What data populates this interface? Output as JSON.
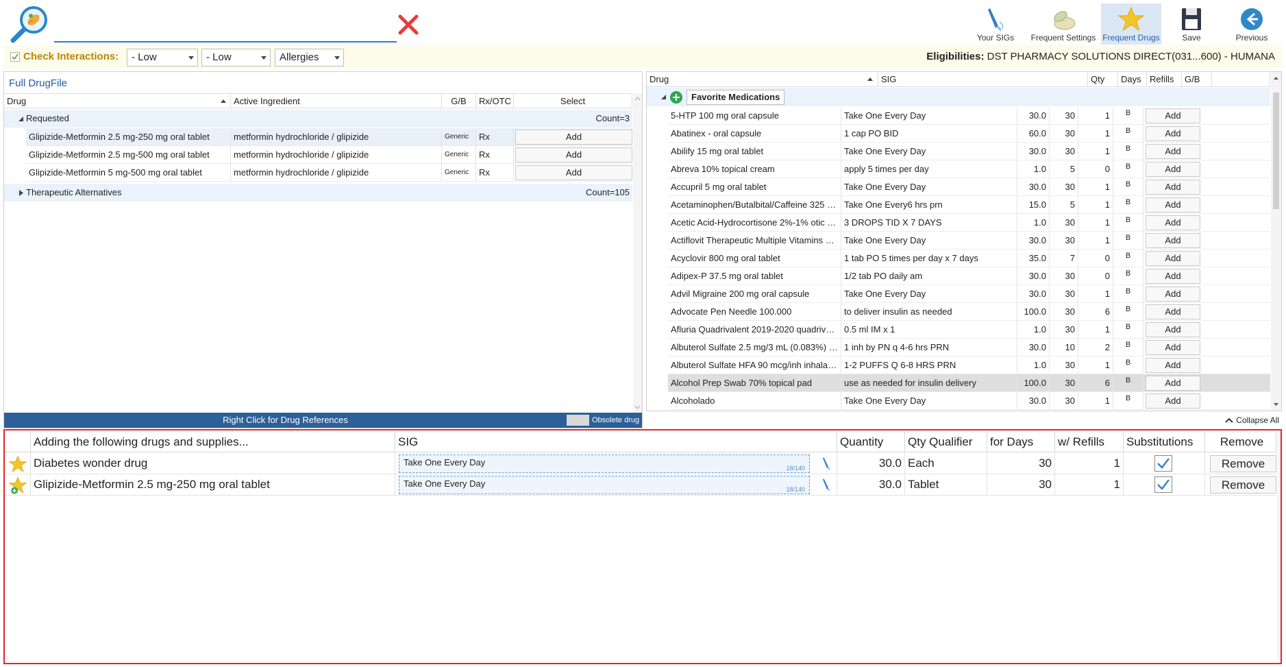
{
  "search": {
    "value": "",
    "placeholder": ""
  },
  "toolbar": {
    "your_sigs": "Your SIGs",
    "frequent_settings": "Frequent Settings",
    "frequent_drugs": "Frequent Drugs",
    "save": "Save",
    "previous": "Previous"
  },
  "interactions": {
    "label": "Check Interactions:",
    "severity1": "- Low",
    "severity2": "- Low",
    "allergies": "Allergies"
  },
  "eligibility": {
    "label": "Eligibilities:",
    "value": "DST PHARMACY SOLUTIONS DIRECT(031...600) - HUMANA"
  },
  "left": {
    "title": "Full DrugFile",
    "columns": {
      "drug": "Drug",
      "ingredient": "Active Ingredient",
      "gb": "G/B",
      "rxotc": "Rx/OTC",
      "select": "Select"
    },
    "requested": {
      "label": "Requested",
      "count": "Count=3"
    },
    "rows": [
      {
        "drug": "Glipizide-Metformin 2.5 mg-250 mg oral tablet",
        "ingredient": "metformin hydrochloride / glipizide",
        "gb": "Generic",
        "rx": "Rx",
        "action": "Add"
      },
      {
        "drug": "Glipizide-Metformin 2.5 mg-500 mg oral tablet",
        "ingredient": "metformin hydrochloride / glipizide",
        "gb": "Generic",
        "rx": "Rx",
        "action": "Add"
      },
      {
        "drug": "Glipizide-Metformin 5 mg-500 mg oral tablet",
        "ingredient": "metformin hydrochloride / glipizide",
        "gb": "Generic",
        "rx": "Rx",
        "action": "Add"
      }
    ],
    "alternatives": {
      "label": "Therapeutic Alternatives",
      "count": "Count=105"
    },
    "footer": "Right Click for Drug References",
    "obsolete": "Obsolete drug"
  },
  "right": {
    "columns": {
      "drug": "Drug",
      "sig": "SIG",
      "qty": "Qty",
      "days": "Days",
      "refills": "Refills",
      "gb": "G/B"
    },
    "group": "Favorite Medications",
    "rows": [
      {
        "drug": "5-HTP 100 mg oral capsule",
        "sig": "Take One Every Day",
        "qty": "30.0",
        "days": "30",
        "refills": "1",
        "gb": "B",
        "action": "Add"
      },
      {
        "drug": "Abatinex - oral capsule",
        "sig": "1 cap PO BID",
        "qty": "60.0",
        "days": "30",
        "refills": "1",
        "gb": "B",
        "action": "Add"
      },
      {
        "drug": "Abilify 15 mg oral tablet",
        "sig": "Take One Every Day",
        "qty": "30.0",
        "days": "30",
        "refills": "1",
        "gb": "B",
        "action": "Add"
      },
      {
        "drug": "Abreva 10% topical cream",
        "sig": "apply 5 times per day",
        "qty": "1.0",
        "days": "5",
        "refills": "0",
        "gb": "B",
        "action": "Add"
      },
      {
        "drug": "Accupril 5 mg oral tablet",
        "sig": "Take One Every Day",
        "qty": "30.0",
        "days": "30",
        "refills": "1",
        "gb": "B",
        "action": "Add"
      },
      {
        "drug": "Acetaminophen/Butalbital/Caffeine 325 mg-5...",
        "sig": "Take One Every6 hrs prn",
        "qty": "15.0",
        "days": "5",
        "refills": "1",
        "gb": "B",
        "action": "Add"
      },
      {
        "drug": "Acetic Acid-Hydrocortisone 2%-1% otic solution",
        "sig": "3 DROPS TID X 7 DAYS",
        "qty": "1.0",
        "days": "30",
        "refills": "1",
        "gb": "B",
        "action": "Add"
      },
      {
        "drug": "Actiflovit Therapeutic Multiple Vitamins with...",
        "sig": "Take One Every Day",
        "qty": "30.0",
        "days": "30",
        "refills": "1",
        "gb": "B",
        "action": "Add"
      },
      {
        "drug": "Acyclovir 800 mg oral tablet",
        "sig": "1 tab PO 5 times per day x 7 days",
        "qty": "35.0",
        "days": "7",
        "refills": "0",
        "gb": "B",
        "action": "Add"
      },
      {
        "drug": "Adipex-P 37.5 mg oral tablet",
        "sig": "1/2 tab PO daily am",
        "qty": "30.0",
        "days": "30",
        "refills": "0",
        "gb": "B",
        "action": "Add"
      },
      {
        "drug": "Advil Migraine 200 mg oral capsule",
        "sig": "Take One Every Day",
        "qty": "30.0",
        "days": "30",
        "refills": "1",
        "gb": "B",
        "action": "Add"
      },
      {
        "drug": "Advocate Pen Needle 100.000",
        "sig": "to deliver insulin as needed",
        "qty": "100.0",
        "days": "30",
        "refills": "6",
        "gb": "B",
        "action": "Add"
      },
      {
        "drug": "Afluria Quadrivalent 2019-2020 quadrivalent i...",
        "sig": "0.5 ml IM x 1",
        "qty": "1.0",
        "days": "30",
        "refills": "1",
        "gb": "B",
        "action": "Add"
      },
      {
        "drug": "Albuterol Sulfate 2.5 mg/3 mL (0.083%) inhala...",
        "sig": "1 inh by PN q 4-6 hrs PRN",
        "qty": "30.0",
        "days": "10",
        "refills": "2",
        "gb": "B",
        "action": "Add"
      },
      {
        "drug": "Albuterol Sulfate HFA 90 mcg/inh inhalation a...",
        "sig": "1-2 PUFFS Q 6-8 HRS PRN",
        "qty": "1.0",
        "days": "30",
        "refills": "1",
        "gb": "B",
        "action": "Add"
      },
      {
        "drug": "Alcohol Prep Swab 70% topical pad",
        "sig": "use as needed for insulin delivery",
        "qty": "100.0",
        "days": "30",
        "refills": "6",
        "gb": "B",
        "action": "Add"
      },
      {
        "drug": "Alcoholado",
        "sig": "Take One Every Day",
        "qty": "30.0",
        "days": "30",
        "refills": "1",
        "gb": "B",
        "action": "Add"
      }
    ],
    "collapse_all": "Collapse All"
  },
  "bottom": {
    "columns": {
      "drug": "Adding the following drugs and supplies...",
      "sig": "SIG",
      "quantity": "Quantity",
      "qualifier": "Qty Qualifier",
      "days": "for Days",
      "refills": "w/ Refills",
      "subs": "Substitutions",
      "remove": "Remove"
    },
    "rows": [
      {
        "drug": "Diabetes wonder drug",
        "sig": "Take One Every Day",
        "count": "18/140",
        "quantity": "30.0",
        "qualifier": "Each",
        "days": "30",
        "refills": "1",
        "remove": "Remove"
      },
      {
        "drug": "Glipizide-Metformin 2.5 mg-250 mg oral tablet",
        "sig": "Take One Every Day",
        "count": "18/140",
        "quantity": "30.0",
        "qualifier": "Tablet",
        "days": "30",
        "refills": "1",
        "remove": "Remove"
      }
    ]
  },
  "colors": {
    "accent": "#1f5da8",
    "footer": "#2d5f98",
    "highlight_border": "#e0262f",
    "interaction_label": "#b8860b"
  }
}
